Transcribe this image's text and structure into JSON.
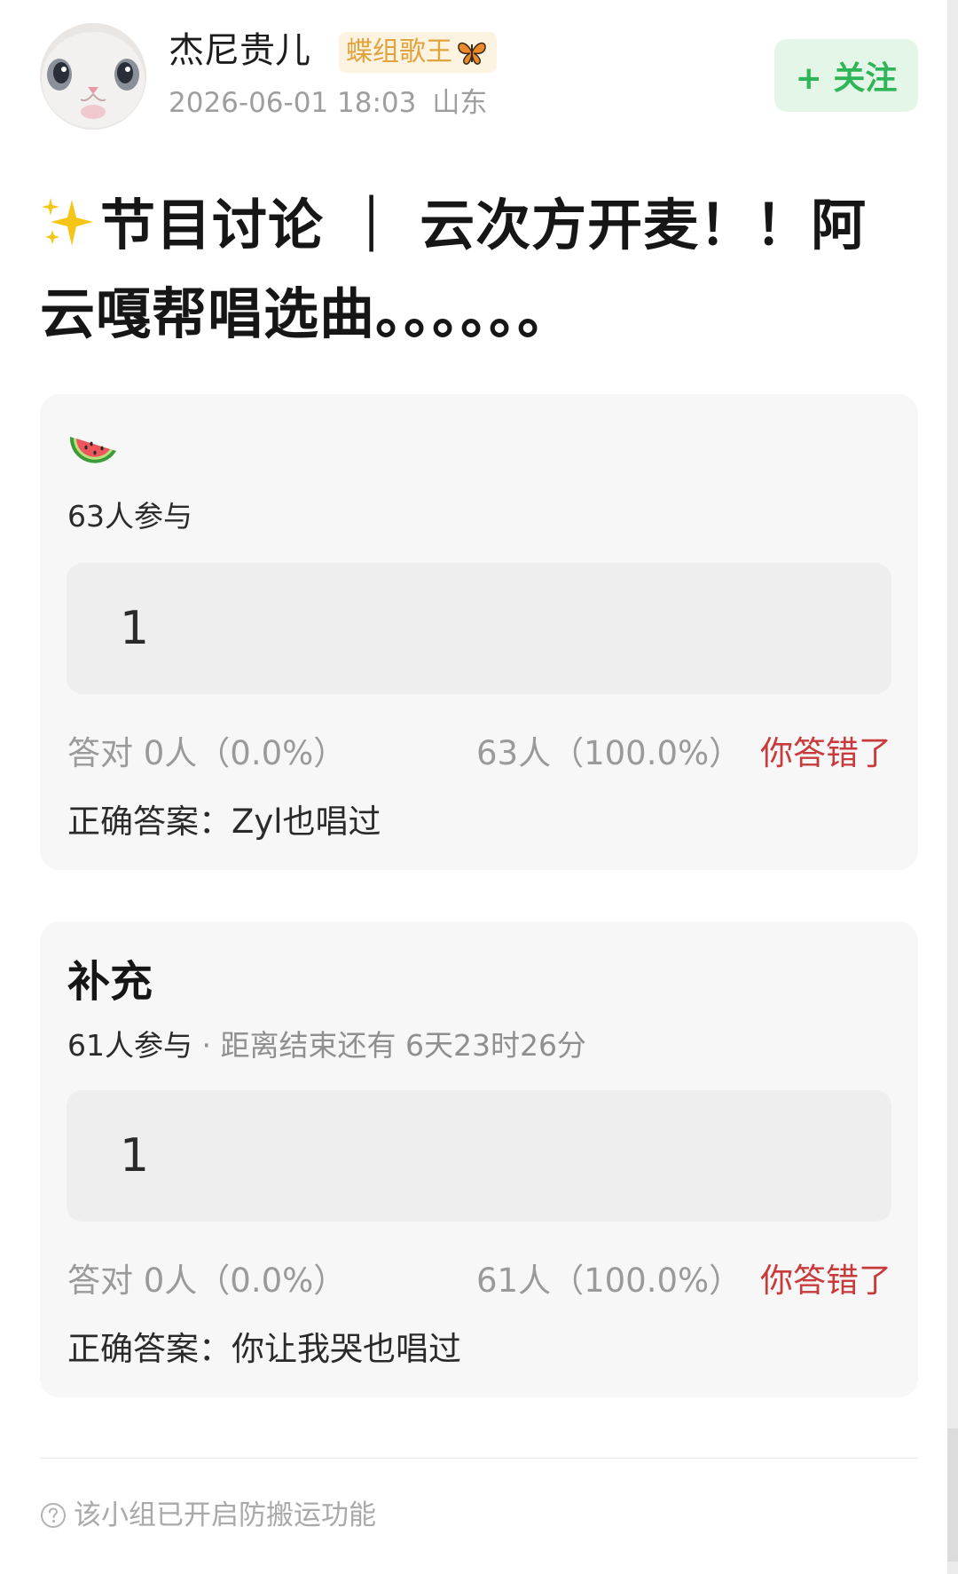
{
  "post": {
    "author": {
      "name": "杰尼贵儿",
      "badge": "蝶组歌王",
      "badge_icon": "butterfly-icon",
      "avatar": "cat-avatar"
    },
    "date": "2026-06-01 18:03",
    "location": "山东",
    "follow_label": "+ 关注",
    "title": "节目讨论 ｜ 云次方开麦！！阿云嘎帮唱选曲。。。。。。",
    "title_icon": "sparkles-icon"
  },
  "quizzes": [
    {
      "header_icon": "watermelon-icon",
      "title": "",
      "participants": "63人参与",
      "deadline": "",
      "option_label": "1",
      "correct_stat": "答对  0人（0.0%）",
      "wrong_stat": "63人（100.0%）",
      "verdict": "你答错了",
      "answer": "正确答案：Zyl也唱过"
    },
    {
      "header_icon": "",
      "title": "补充",
      "participants": "61人参与",
      "deadline": " · 距离结束还有 6天23时26分",
      "option_label": "1",
      "correct_stat": "答对  0人（0.0%）",
      "wrong_stat": "61人（100.0%）",
      "verdict": "你答错了",
      "answer": "正确答案：你让我哭也唱过"
    }
  ],
  "footer": {
    "notice": "该小组已开启防搬运功能",
    "notice_icon": "help-circle-icon"
  },
  "colors": {
    "follow_green": "#2fb458",
    "follow_bg": "#e4f6e8",
    "badge_gold": "#e0a33e",
    "badge_bg": "#fdf3e1",
    "wrong_red": "#c93b3b",
    "card_bg": "#f7f7f7",
    "option_bg": "#eeeeee"
  }
}
